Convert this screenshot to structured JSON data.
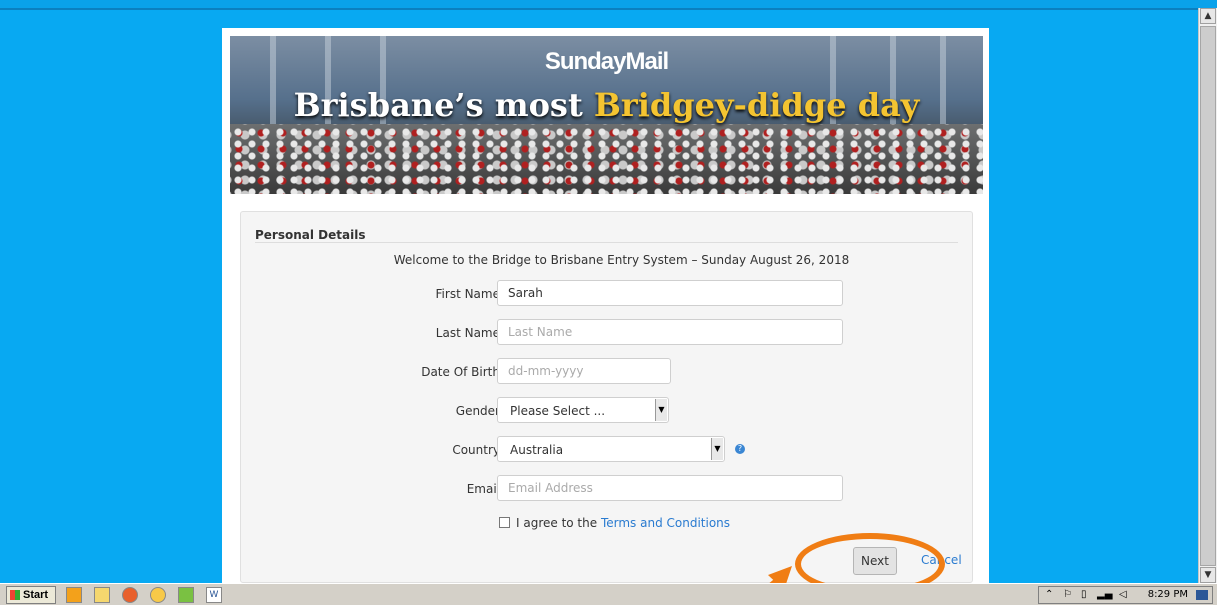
{
  "banner": {
    "logo": "SundayMail",
    "headline_part1": "Brisbane’s most ",
    "headline_highlight": "Bridgey-didge day",
    "highlight_color": "#f4c431"
  },
  "form": {
    "section_title": "Personal Details",
    "welcome": "Welcome to the Bridge to Brisbane Entry System – Sunday August 26, 2018",
    "first_name": {
      "label": "First Name",
      "value": "Sarah"
    },
    "last_name": {
      "label": "Last Name",
      "placeholder": "Last Name"
    },
    "dob": {
      "label": "Date Of Birth",
      "placeholder": "dd-mm-yyyy"
    },
    "gender": {
      "label": "Gender",
      "selected": "Please Select ..."
    },
    "country": {
      "label": "Country",
      "selected": "Australia",
      "help_icon": "info-icon"
    },
    "email": {
      "label": "Email",
      "placeholder": "Email Address"
    },
    "agree_text": "I agree to the ",
    "terms_link": "Terms and Conditions",
    "next_label": "Next",
    "cancel_label": "Cancel"
  },
  "taskbar": {
    "start_label": "Start",
    "clock": "8:29 PM",
    "icons": [
      "media-player-icon",
      "folder-icon",
      "firefox-icon",
      "clock-app-icon",
      "notepad-icon",
      "word-icon"
    ]
  },
  "colors": {
    "desktop_bg": "#08a9f2",
    "link": "#2a7bd0",
    "annotation": "#f07d14"
  }
}
